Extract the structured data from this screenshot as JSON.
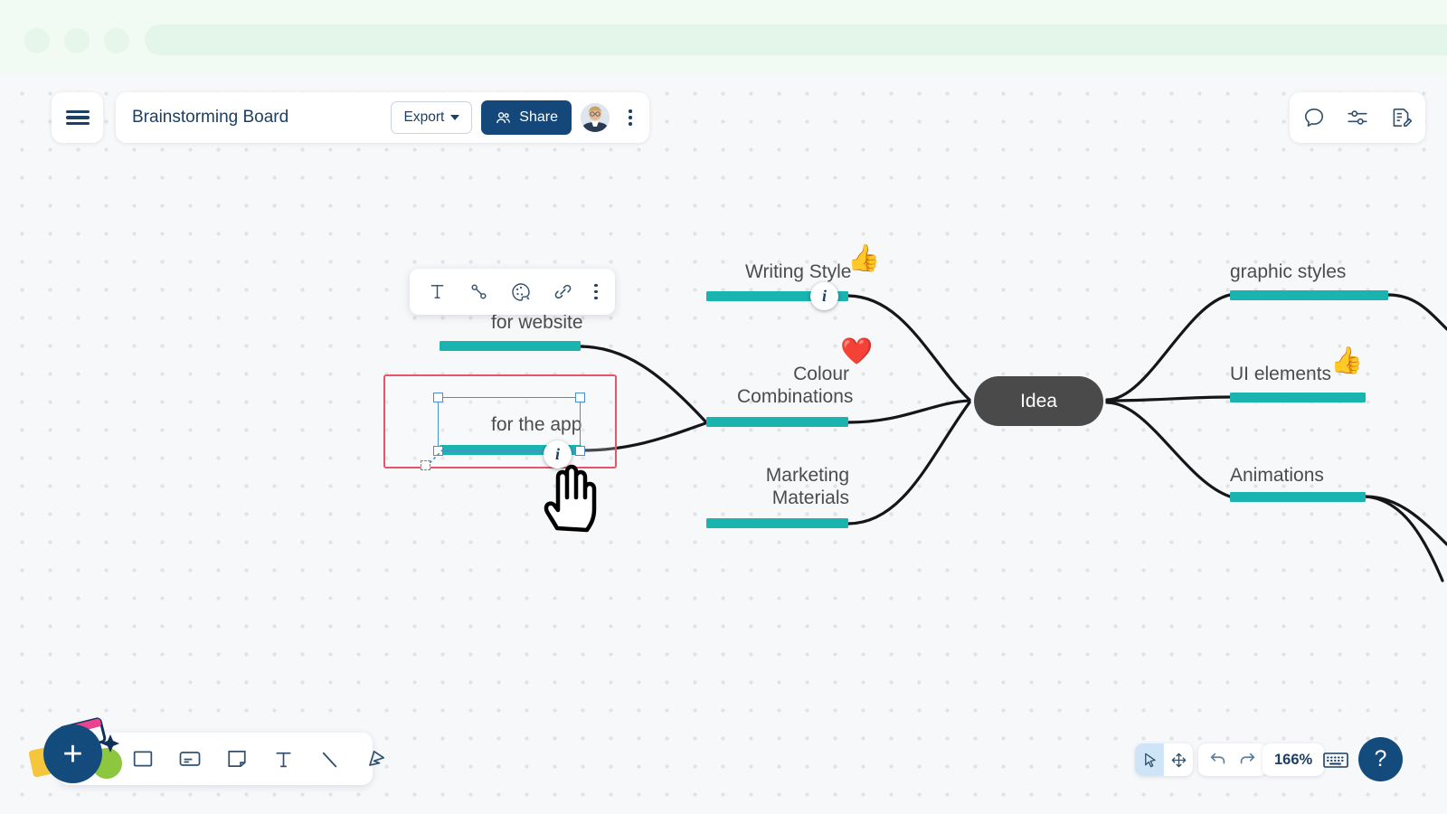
{
  "chrome": {
    "dots": [
      "window-dot-1",
      "window-dot-2",
      "window-dot-3"
    ],
    "addressbar_value": ""
  },
  "header": {
    "menu_icon": "hamburger-icon",
    "board_title": "Brainstorming Board",
    "export_label": "Export",
    "share_label": "Share",
    "avatar_name": "user-avatar",
    "more_icon": "vertical-dots-icon"
  },
  "topright": {
    "icons": [
      {
        "name": "comment-icon",
        "label": "Comments"
      },
      {
        "name": "sliders-icon",
        "label": "Settings"
      },
      {
        "name": "edit-document-icon",
        "label": "Notes"
      }
    ]
  },
  "element_toolbar": {
    "items": [
      {
        "name": "text-format-icon",
        "label": "Text"
      },
      {
        "name": "connector-icon",
        "label": "Connector"
      },
      {
        "name": "color-palette-icon",
        "label": "Colors"
      },
      {
        "name": "link-attach-icon",
        "label": "Link"
      },
      {
        "name": "more-options-icon",
        "label": "More"
      }
    ]
  },
  "mindmap": {
    "center": {
      "label": "Idea",
      "color": "#4a4a4a"
    },
    "bar_color": "#19b3b0",
    "nodes": [
      {
        "id": "for-website",
        "label": "for website",
        "emoji": "",
        "badge": ""
      },
      {
        "id": "for-the-app",
        "label": "for the app",
        "emoji": "",
        "badge": "i"
      },
      {
        "id": "writing-style",
        "label": "Writing Style",
        "emoji": "👍",
        "badge": "i"
      },
      {
        "id": "colour-combinations",
        "label": "Colour\nCombinations",
        "line1": "Colour",
        "line2": "Combinations",
        "emoji": "❤️",
        "badge": ""
      },
      {
        "id": "marketing-materials",
        "label": "Marketing\nMaterials",
        "line1": "Marketing",
        "line2": "Materials",
        "emoji": "",
        "badge": ""
      },
      {
        "id": "graphic-styles",
        "label": "graphic styles",
        "emoji": "",
        "badge": ""
      },
      {
        "id": "ui-elements",
        "label": "UI elements",
        "emoji": "👍",
        "badge": ""
      },
      {
        "id": "animations",
        "label": "Animations",
        "emoji": "",
        "badge": ""
      }
    ]
  },
  "selection": {
    "highlight_color": "#e8546a",
    "handle_color": "#4a8fc9",
    "selected_node": "for the app"
  },
  "bottom_toolbar": {
    "add_label": "+",
    "tools": [
      {
        "name": "rectangle-shape-icon",
        "label": "Shape"
      },
      {
        "name": "card-icon",
        "label": "Card"
      },
      {
        "name": "sticky-note-icon",
        "label": "Note"
      },
      {
        "name": "text-tool-icon",
        "label": "Text"
      },
      {
        "name": "line-tool-icon",
        "label": "Line"
      },
      {
        "name": "marker-pen-icon",
        "label": "Draw"
      }
    ]
  },
  "bottom_right": {
    "select_mode_icon": "cursor-arrow-icon",
    "pan_mode_icon": "move-arrows-icon",
    "undo_icon": "undo-arrow-icon",
    "redo_icon": "redo-arrow-icon",
    "zoom_level": "166%",
    "keyboard_icon": "keyboard-icon",
    "help_label": "?"
  }
}
